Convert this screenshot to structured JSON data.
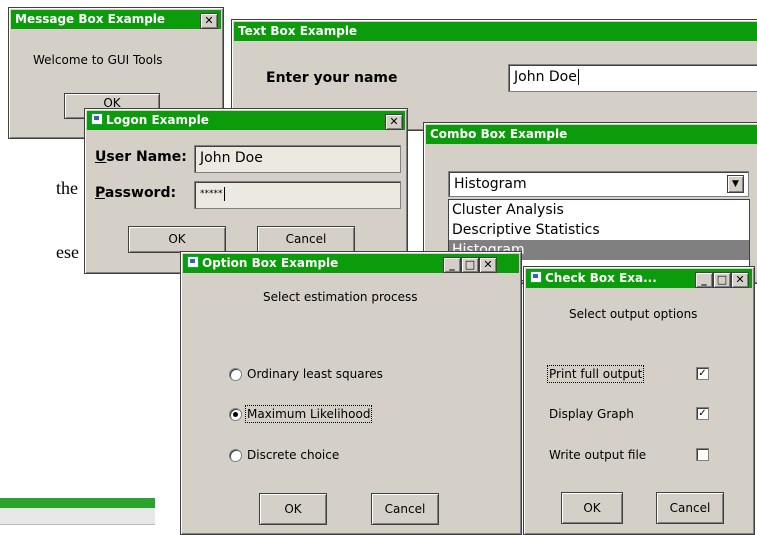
{
  "doc": {
    "fragment1": "the",
    "fragment2": "ese"
  },
  "message_box": {
    "title": "Message Box Example",
    "message": "Welcome to GUI Tools",
    "ok": "OK"
  },
  "text_box": {
    "title": "Text Box Example",
    "label": "Enter your name",
    "value": "John Doe"
  },
  "logon": {
    "title": "Logon Example",
    "user_label_u": "U",
    "user_label": "ser Name:",
    "user_value": "John Doe",
    "pass_label_u": "P",
    "pass_label": "assword:",
    "pass_value": "*****",
    "ok": "OK",
    "cancel": "Cancel"
  },
  "combo": {
    "title": "Combo Box Example",
    "selected": "Histogram",
    "options": [
      "Cluster Analysis",
      "Descriptive Statistics",
      "Histogram"
    ]
  },
  "option_box": {
    "title": "Option Box Example",
    "prompt": "Select estimation process",
    "options": [
      "Ordinary least squares",
      "Maximum Likelihood",
      "Discrete choice"
    ],
    "selected": "Maximum Likelihood",
    "ok": "OK",
    "cancel": "Cancel"
  },
  "check_box": {
    "title": "Check Box Exa...",
    "prompt": "Select output options",
    "options": [
      {
        "label": "Print full output",
        "checked": true
      },
      {
        "label": "Display Graph",
        "checked": true
      },
      {
        "label": "Write output file",
        "checked": false
      }
    ],
    "ok": "OK",
    "cancel": "Cancel"
  },
  "icons": {
    "close": "close-icon",
    "minimize": "minimize-icon",
    "maximize": "maximize-icon",
    "app": "window-app-icon"
  }
}
